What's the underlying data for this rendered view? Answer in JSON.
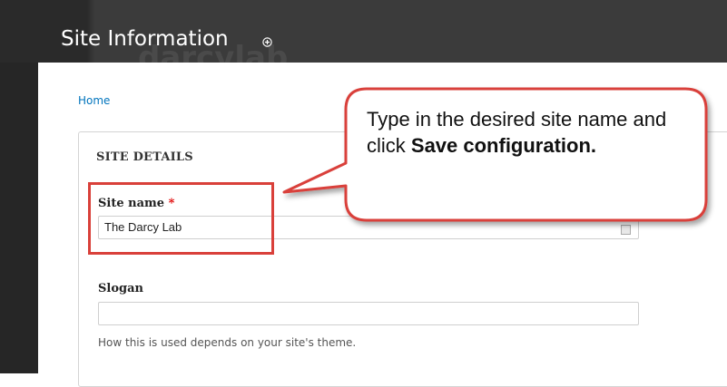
{
  "header": {
    "title": "Site Information",
    "ghost_text": "darcylab"
  },
  "breadcrumb": {
    "home": "Home"
  },
  "site_details": {
    "legend": "SITE DETAILS",
    "site_name": {
      "label": "Site name",
      "required_marker": "*",
      "value": "The Darcy Lab"
    },
    "slogan": {
      "label": "Slogan",
      "value": "",
      "description": "How this is used depends on your site's theme."
    }
  },
  "callout": {
    "text_plain": "Type in the desired site name and click ",
    "text_bold": "Save configuration.",
    "color": "#d9403a"
  },
  "colors": {
    "highlight": "#d9403a",
    "link": "#0074bd",
    "required": "#e00000"
  }
}
